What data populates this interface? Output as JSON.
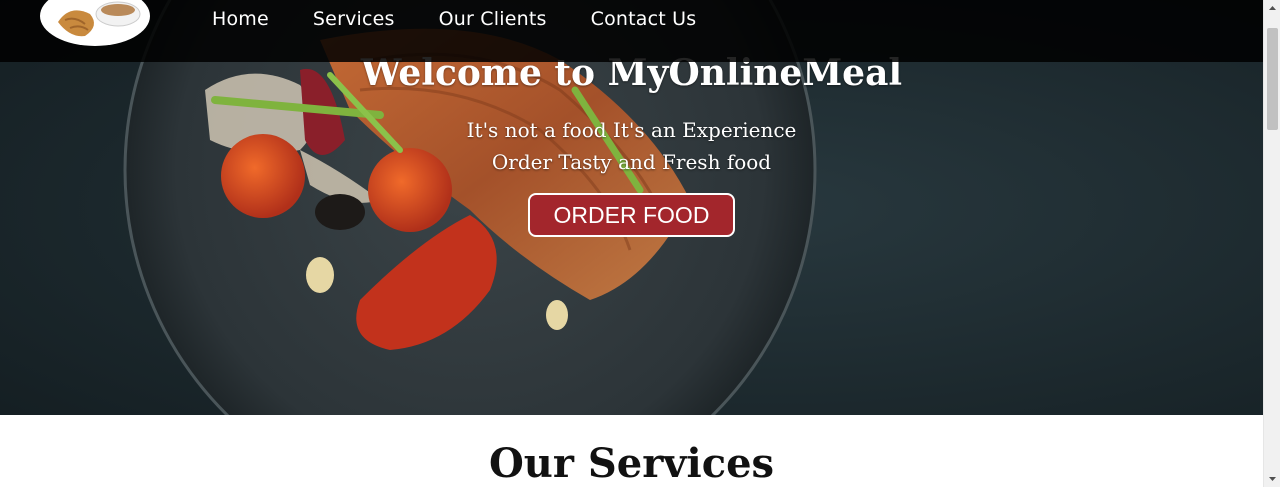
{
  "nav": {
    "items": [
      {
        "label": "Home"
      },
      {
        "label": "Services"
      },
      {
        "label": "Our Clients"
      },
      {
        "label": "Contact Us"
      }
    ]
  },
  "hero": {
    "title": "Welcome to MyOnlineMeal",
    "tagline_1": "It's not a food It's an Experience",
    "tagline_2": "Order Tasty and Fresh food",
    "cta_label": "ORDER FOOD"
  },
  "services": {
    "title": "Our Services"
  },
  "colors": {
    "cta_background": "#a3262c",
    "navbar_background": "#000000",
    "text_light": "#ffffff",
    "text_dark": "#111111"
  },
  "icons": {
    "logo": "croissant-coffee-logo"
  }
}
